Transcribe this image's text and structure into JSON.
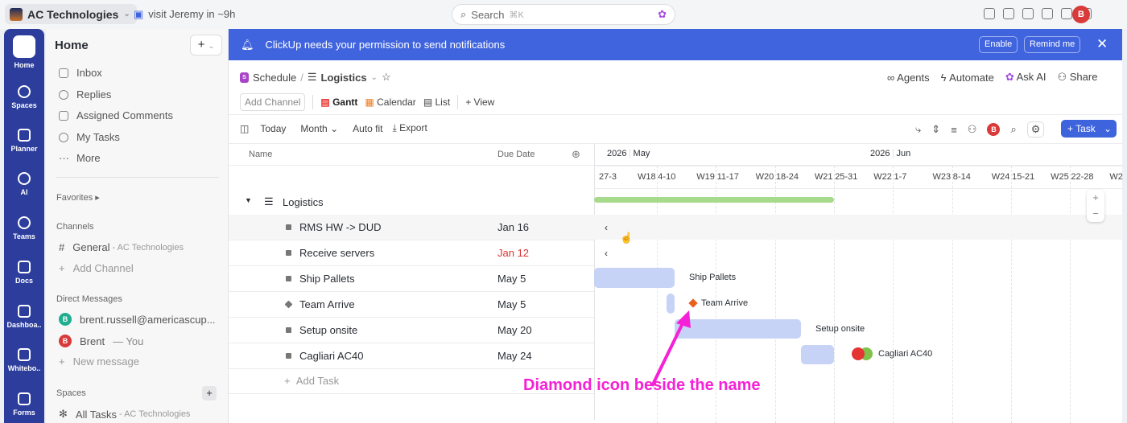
{
  "topbar": {
    "workspace": "AC Technologies",
    "reminder": "visit Jeremy in ~9h",
    "search": "Search",
    "shortcut": "⌘K",
    "avatar": "B"
  },
  "rail": [
    {
      "label": "Home"
    },
    {
      "label": "Spaces"
    },
    {
      "label": "Planner"
    },
    {
      "label": "AI"
    },
    {
      "label": "Teams"
    },
    {
      "label": "Docs"
    },
    {
      "label": "Dashboa.."
    },
    {
      "label": "Whitebo.."
    },
    {
      "label": "Forms"
    }
  ],
  "sidebar": {
    "title": "Home",
    "items": [
      "Inbox",
      "Replies",
      "Assigned Comments",
      "My Tasks",
      "More"
    ],
    "favorites": "Favorites",
    "channels_header": "Channels",
    "channel": "General",
    "channel_ws": "- AC Technologies",
    "add_channel": "Add Channel",
    "dm_header": "Direct Messages",
    "dm1": "brent.russell@americascup...",
    "dm2": "Brent",
    "dm2_you": "— You",
    "new_message": "New message",
    "spaces_header": "Spaces",
    "all_tasks": "All Tasks",
    "all_tasks_ws": "- AC Technologies"
  },
  "banner": {
    "text": "ClickUp needs your permission to send notifications",
    "enable": "Enable",
    "remind": "Remind me"
  },
  "header": {
    "space": "Schedule",
    "space_badge": "S",
    "list": "Logistics",
    "agents": "Agents",
    "automate": "Automate",
    "ask_ai": "Ask AI",
    "share": "Share"
  },
  "views": {
    "add_channel": "Add Channel",
    "gantt": "Gantt",
    "calendar": "Calendar",
    "list": "List",
    "add_view": "View"
  },
  "toolbar": {
    "today": "Today",
    "month": "Month",
    "autofit": "Auto fit",
    "export": "Export",
    "task": "Task"
  },
  "table": {
    "col_name": "Name",
    "col_due": "Due Date",
    "group": "Logistics",
    "add_task": "Add Task",
    "rows": [
      {
        "name": "RMS HW -> DUD",
        "due": "Jan 16",
        "overdue": false
      },
      {
        "name": "Receive servers",
        "due": "Jan 12",
        "overdue": true
      },
      {
        "name": "Ship Pallets",
        "due": "May 5",
        "overdue": false
      },
      {
        "name": "Team Arrive",
        "due": "May 5",
        "overdue": false
      },
      {
        "name": "Setup onsite",
        "due": "May 20",
        "overdue": false
      },
      {
        "name": "Cagliari AC40",
        "due": "May 24",
        "overdue": false
      }
    ]
  },
  "gantt": {
    "year1": "2026",
    "month1": "May",
    "year2": "2026",
    "month2": "Jun",
    "weeks": [
      [
        "27-3",
        "W18"
      ],
      [
        "4-10",
        "W19"
      ],
      [
        "11-17",
        "W20"
      ],
      [
        "18-24",
        "W21"
      ],
      [
        "25-31",
        "W22"
      ],
      [
        "1-7",
        "W23"
      ],
      [
        "8-14",
        "W24"
      ],
      [
        "15-21",
        "W25"
      ],
      [
        "22-28",
        "W2"
      ]
    ],
    "labels": {
      "ship": "Ship Pallets",
      "team": "Team Arrive",
      "setup": "Setup onsite",
      "cagliari": "Cagliari AC40"
    }
  },
  "annotation": "Diamond icon beside the name"
}
